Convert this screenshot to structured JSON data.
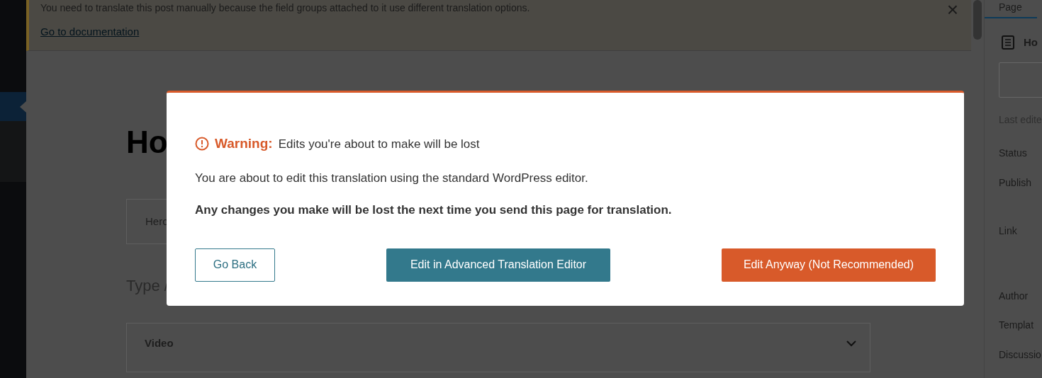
{
  "notice": {
    "message": "You need to translate this post manually because the field groups attached to it use different translation options.",
    "link": "Go to documentation",
    "close": "×"
  },
  "editor": {
    "title": "Ho",
    "blocks": [
      {
        "kind": "block",
        "label": "Hero"
      },
      {
        "kind": "placeholder",
        "label": "Type /"
      },
      {
        "kind": "accordion",
        "label": "Video",
        "expanded": false
      }
    ]
  },
  "settings_sidebar": {
    "tab": {
      "label": "Page",
      "selected": true
    },
    "page_title": "Ho",
    "last_edited": "Last edite",
    "rows": [
      "Status",
      "Publish",
      "Link",
      "Author",
      "Templat",
      "Discussio"
    ]
  },
  "dialog": {
    "warning_label": "Warning:",
    "warning_text": "Edits you're about to make will be lost",
    "paragraph": "You are about to edit this translation using the standard WordPress editor.",
    "emphasis": "Any changes you make will be lost the next time you send this page for translation.",
    "buttons": [
      {
        "kind": "secondary",
        "label": "Go Back"
      },
      {
        "kind": "primary",
        "label": "Edit in Advanced Translation Editor"
      },
      {
        "kind": "danger",
        "label": "Edit Anyway (Not Recommended)"
      }
    ]
  }
}
